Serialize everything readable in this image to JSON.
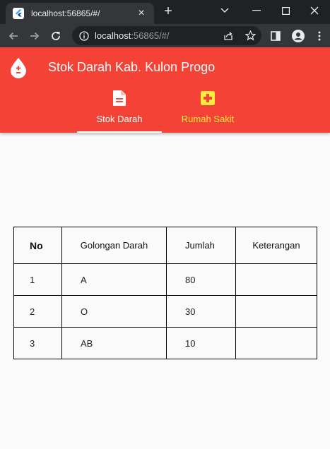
{
  "browser": {
    "tab_title": "localhost:56865/#/",
    "url_host": "localhost",
    "url_rest": ":56865/#/"
  },
  "app": {
    "title": "Stok Darah Kab. Kulon Progo",
    "colors": {
      "primary": "#f44336",
      "accent": "#ffeb3b"
    },
    "tabs": [
      {
        "label": "Stok Darah",
        "icon": "document-icon",
        "selected": true
      },
      {
        "label": "Rumah Sakit",
        "icon": "hospital-icon",
        "selected": false
      }
    ]
  },
  "table": {
    "headers": [
      "No",
      "Golongan Darah",
      "Jumlah",
      "Keterangan"
    ],
    "rows": [
      [
        "1",
        "A",
        "80",
        ""
      ],
      [
        "2",
        "O",
        "30",
        ""
      ],
      [
        "3",
        "AB",
        "10",
        ""
      ]
    ]
  }
}
